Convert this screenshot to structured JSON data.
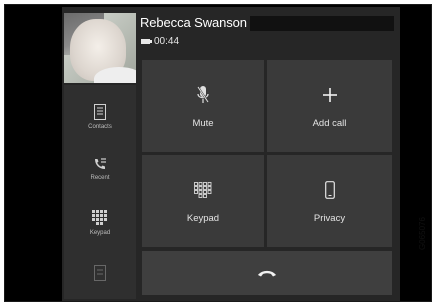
{
  "call": {
    "caller_name": "Rebecca Swanson",
    "duration": "00:44"
  },
  "sidebar": {
    "items": [
      {
        "label": "Contacts",
        "icon": "contacts-icon"
      },
      {
        "label": "Recent",
        "icon": "recent-calls-icon"
      },
      {
        "label": "Keypad",
        "icon": "keypad-icon"
      },
      {
        "label": "",
        "icon": "messages-icon"
      }
    ]
  },
  "actions": {
    "mute": {
      "label": "Mute",
      "icon": "microphone-muted-icon"
    },
    "add_call": {
      "label": "Add call",
      "icon": "plus-icon"
    },
    "keypad": {
      "label": "Keypad",
      "icon": "keypad-icon"
    },
    "privacy": {
      "label": "Privacy",
      "icon": "phone-handset-icon"
    },
    "end_call": {
      "icon": "end-call-icon"
    }
  },
  "figure_code": "G065076",
  "colors": {
    "screen_bg": "#262626",
    "tile_bg": "#3a3a3a",
    "text": "#e6e6e6"
  }
}
